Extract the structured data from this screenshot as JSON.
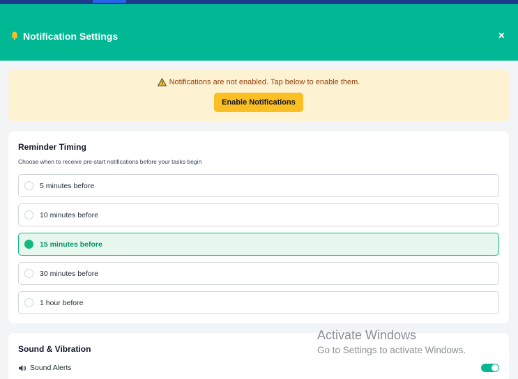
{
  "header": {
    "title": "Notification Settings",
    "close_label": "×",
    "bell_icon": "bell-icon",
    "close_icon": "close-icon",
    "colors": {
      "header_bg": "#00b894",
      "bell": "#fbbf24"
    }
  },
  "alert": {
    "message": "Notifications are not enabled. Tap below to enable them.",
    "button_label": "Enable Notifications",
    "icon": "warning-icon",
    "colors": {
      "bg": "#fdf3d2",
      "button": "#fbbf24"
    }
  },
  "reminder": {
    "title": "Reminder Timing",
    "description": "Choose when to receive pre-start notifications before your tasks begin",
    "options": [
      {
        "label": "5 minutes before",
        "selected": false
      },
      {
        "label": "10 minutes before",
        "selected": false
      },
      {
        "label": "15 minutes before",
        "selected": true
      },
      {
        "label": "30 minutes before",
        "selected": false
      },
      {
        "label": "1 hour before",
        "selected": false
      }
    ],
    "colors": {
      "selected_bg": "#e8f7ee",
      "selected_accent": "#10b981"
    }
  },
  "sound": {
    "title": "Sound & Vibration",
    "alerts_label": "Sound Alerts",
    "alerts_icon": "speaker-icon",
    "alerts_enabled": true
  },
  "watermark": {
    "line1": "Activate Windows",
    "line2": "Go to Settings to activate Windows."
  }
}
